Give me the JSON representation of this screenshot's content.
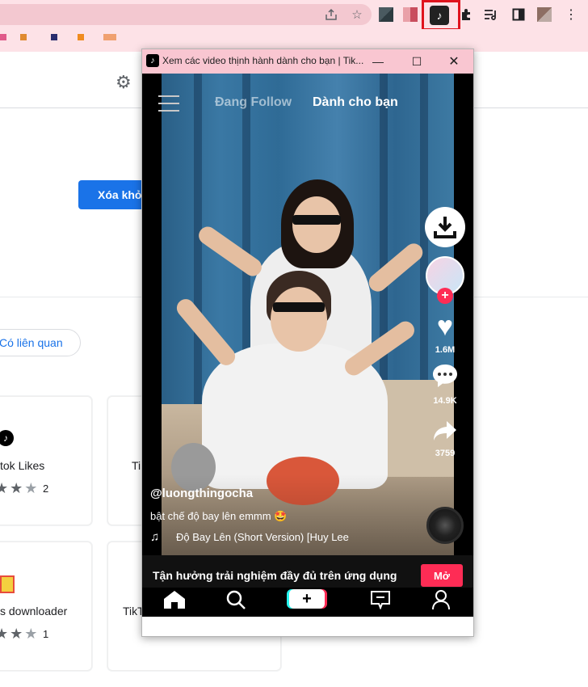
{
  "browser": {
    "share_icon": "share-icon",
    "bookmark_icon": "star-icon",
    "colors": {
      "toolbar": "#fde2e7",
      "highlight": "#e0141e"
    }
  },
  "store": {
    "remove_button_label": "Xóa khỏ",
    "related_chip_label": "Có liên quan",
    "cards": [
      {
        "title": "tok Likes",
        "rating_count": "2"
      },
      {
        "title": "Ti",
        "rating_count": ""
      },
      {
        "title": "s downloader",
        "rating_count": "1"
      },
      {
        "title": "TikT",
        "rating_count": ""
      }
    ]
  },
  "popup": {
    "window_title": "Xem các video thịnh hành dành cho bạn | Tik...",
    "tabs": {
      "following": "Đang Follow",
      "for_you": "Dành cho bạn"
    },
    "video": {
      "username": "@luongthingocha",
      "caption": "bật chế độ bay lên emmm 🤩",
      "music": "Độ Bay Lên (Short Version) [Huy Lee",
      "likes": "1.6M",
      "comments": "14.9K",
      "shares": "3759"
    },
    "banner": {
      "text": "Tận hưởng trải nghiệm đầy đủ trên ứng dụng",
      "open_label": "Mở"
    },
    "colors": {
      "accent": "#fe2c55",
      "titlebar": "#f9c6d1"
    }
  }
}
